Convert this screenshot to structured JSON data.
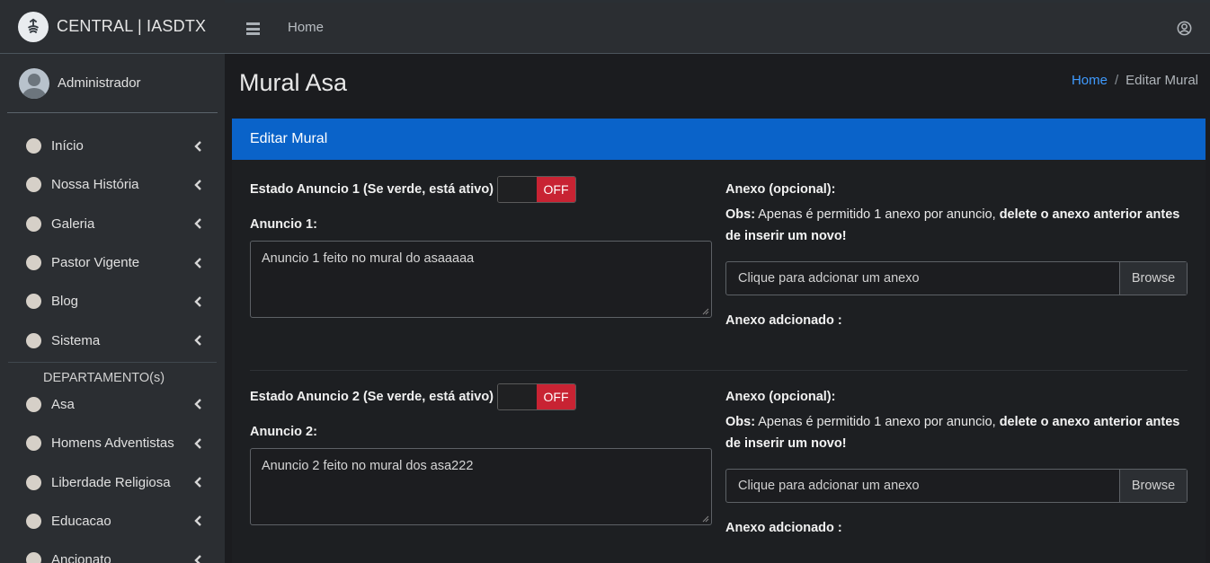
{
  "brand": {
    "name": "CENTRAL | IASDTX"
  },
  "user": {
    "name": "Administrador"
  },
  "sidebar": {
    "items": [
      {
        "label": "Início"
      },
      {
        "label": "Nossa História"
      },
      {
        "label": "Galeria"
      },
      {
        "label": "Pastor Vigente"
      },
      {
        "label": "Blog"
      },
      {
        "label": "Sistema"
      }
    ],
    "section_header": "DEPARTAMENTO(s)",
    "department_items": [
      {
        "label": "Asa"
      },
      {
        "label": "Homens Adventistas"
      },
      {
        "label": "Liberdade Religiosa"
      },
      {
        "label": "Educacao"
      },
      {
        "label": "Ancionato"
      }
    ]
  },
  "topbar": {
    "home_link": "Home"
  },
  "page": {
    "title": "Mural Asa",
    "breadcrumb": {
      "home": "Home",
      "separator": "/",
      "current": "Editar Mural"
    }
  },
  "card": {
    "header": "Editar Mural",
    "anuncios": [
      {
        "toggle_label": "Estado Anuncio 1 (Se verde, está ativo)",
        "toggle_state": "OFF",
        "field_label": "Anuncio 1:",
        "text": "Anuncio 1 feito no mural do asaaaaa",
        "anexo_label": "Anexo (opcional):",
        "obs_prefix": "Obs:",
        "obs_text": " Apenas é permitido 1 anexo por anuncio, ",
        "obs_bold": "delete o anexo anterior antes de inserir um novo!",
        "file_placeholder": "Clique para adcionar um anexo",
        "browse_label": "Browse",
        "anexo_added": "Anexo adcionado :"
      },
      {
        "toggle_label": "Estado Anuncio 2 (Se verde, está ativo)",
        "toggle_state": "OFF",
        "field_label": "Anuncio 2:",
        "text": "Anuncio 2 feito no mural dos asa222",
        "anexo_label": "Anexo (opcional):",
        "obs_prefix": "Obs:",
        "obs_text": " Apenas é permitido 1 anexo por anuncio, ",
        "obs_bold": "delete o anexo anterior antes de inserir um novo!",
        "file_placeholder": "Clique para adcionar um anexo",
        "browse_label": "Browse",
        "anexo_added": "Anexo adcionado :"
      }
    ]
  },
  "colors": {
    "card_header": "#0a63c9",
    "toggle_off": "#c82333",
    "link": "#3f9bff"
  },
  "icons": {
    "menu": "hamburger-icon",
    "user": "user-circle-icon",
    "chevron": "chevron-left-icon",
    "nav_bullet": "circle-icon"
  }
}
